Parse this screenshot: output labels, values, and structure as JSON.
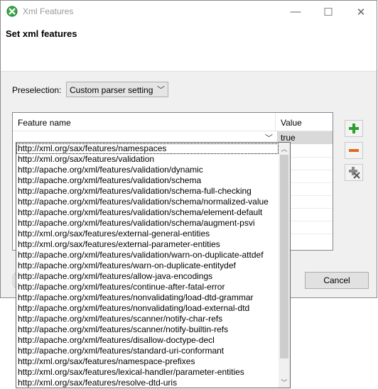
{
  "window": {
    "title": "Xml Features",
    "minimize_glyph": "—",
    "maximize_glyph": "☐",
    "close_glyph": "✕"
  },
  "header": {
    "title": "Set xml features"
  },
  "preselection": {
    "label": "Preselection:",
    "selected": "Custom parser setting"
  },
  "table": {
    "columns": [
      "Feature name",
      "Value"
    ],
    "editing_row": {
      "feature": "",
      "value": "true"
    }
  },
  "side_buttons": [
    {
      "icon": "add-icon",
      "color": "#2e9e2e"
    },
    {
      "icon": "remove-icon",
      "color": "#e06b1a"
    },
    {
      "icon": "delete-all-icon",
      "color": "#7a7a7a"
    }
  ],
  "buttons": {
    "cancel": "Cancel"
  },
  "dropdown": {
    "items": [
      "http://xml.org/sax/features/namespaces",
      "http://xml.org/sax/features/validation",
      "http://apache.org/xml/features/validation/dynamic",
      "http://apache.org/xml/features/validation/schema",
      "http://apache.org/xml/features/validation/schema-full-checking",
      "http://apache.org/xml/features/validation/schema/normalized-value",
      "http://apache.org/xml/features/validation/schema/element-default",
      "http://apache.org/xml/features/validation/schema/augment-psvi",
      "http://xml.org/sax/features/external-general-entities",
      "http://xml.org/sax/features/external-parameter-entities",
      "http://apache.org/xml/features/validation/warn-on-duplicate-attdef",
      "http://apache.org/xml/features/warn-on-duplicate-entitydef",
      "http://apache.org/xml/features/allow-java-encodings",
      "http://apache.org/xml/features/continue-after-fatal-error",
      "http://apache.org/xml/features/nonvalidating/load-dtd-grammar",
      "http://apache.org/xml/features/nonvalidating/load-external-dtd",
      "http://apache.org/xml/features/scanner/notify-char-refs",
      "http://apache.org/xml/features/scanner/notify-builtin-refs",
      "http://apache.org/xml/features/disallow-doctype-decl",
      "http://apache.org/xml/features/standard-uri-conformant",
      "http://xml.org/sax/features/namespace-prefixes",
      "http://xml.org/sax/features/lexical-handler/parameter-entities",
      "http://xml.org/sax/features/resolve-dtd-uris"
    ],
    "selected_index": 0
  }
}
